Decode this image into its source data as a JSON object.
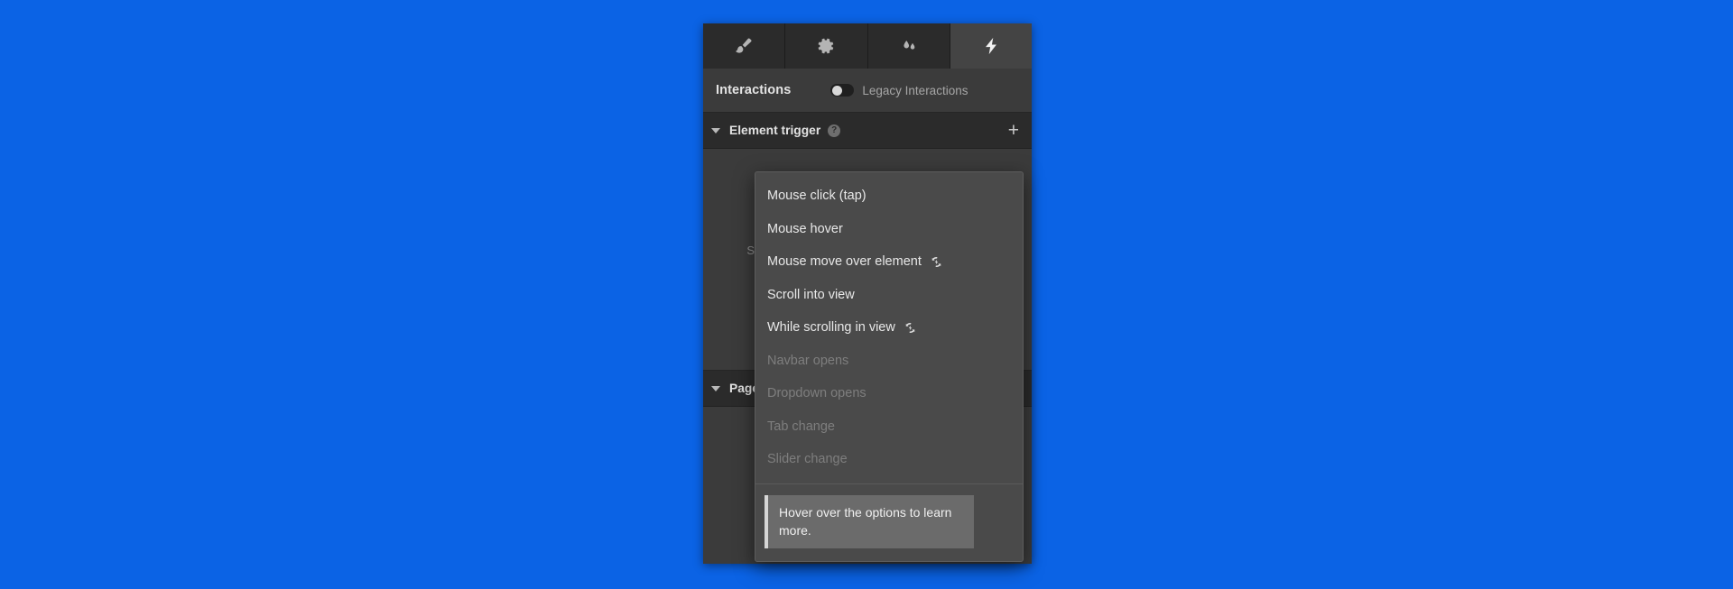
{
  "background_color": "#0b63e5",
  "panel": {
    "tabs": [
      {
        "name": "style-tab",
        "icon": "paintbrush-icon",
        "active": false
      },
      {
        "name": "settings-tab",
        "icon": "gear-icon",
        "active": false
      },
      {
        "name": "styles-tab",
        "icon": "water-drops-icon",
        "active": false
      },
      {
        "name": "interactions-tab",
        "icon": "lightning-icon",
        "active": true
      }
    ],
    "header": {
      "title": "Interactions",
      "legacy_label": "Legacy Interactions",
      "legacy_toggle_on": false
    },
    "sections": [
      {
        "name": "element-trigger",
        "title": "Element trigger",
        "help": "?",
        "add_label": "+",
        "expanded": true,
        "empty_message": "Select an element by clicking on the canvas or element list"
      },
      {
        "name": "page-trigger",
        "title": "Page trigger",
        "help": "?",
        "add_label": "+",
        "expanded": true
      }
    ]
  },
  "dropdown": {
    "name": "element-trigger-dropdown",
    "items": [
      {
        "label": "Mouse click (tap)",
        "disabled": false,
        "live": false
      },
      {
        "label": "Mouse hover",
        "disabled": false,
        "live": false
      },
      {
        "label": "Mouse move over element",
        "disabled": false,
        "live": true
      },
      {
        "label": "Scroll into view",
        "disabled": false,
        "live": false
      },
      {
        "label": "While scrolling in view",
        "disabled": false,
        "live": true
      },
      {
        "label": "Navbar opens",
        "disabled": true,
        "live": false
      },
      {
        "label": "Dropdown opens",
        "disabled": true,
        "live": false
      },
      {
        "label": "Tab change",
        "disabled": true,
        "live": false
      },
      {
        "label": "Slider change",
        "disabled": true,
        "live": false
      }
    ],
    "tooltip": "Hover over the options to learn more.",
    "live_icon": "loop-lightning-icon"
  },
  "colors": {
    "panel_bg": "#2e2e2e",
    "tab_active": "#444444",
    "dropdown_bg": "#4a4a4a",
    "tooltip_bg": "#6b6b6b",
    "accent_blue": "#0b63e5"
  }
}
